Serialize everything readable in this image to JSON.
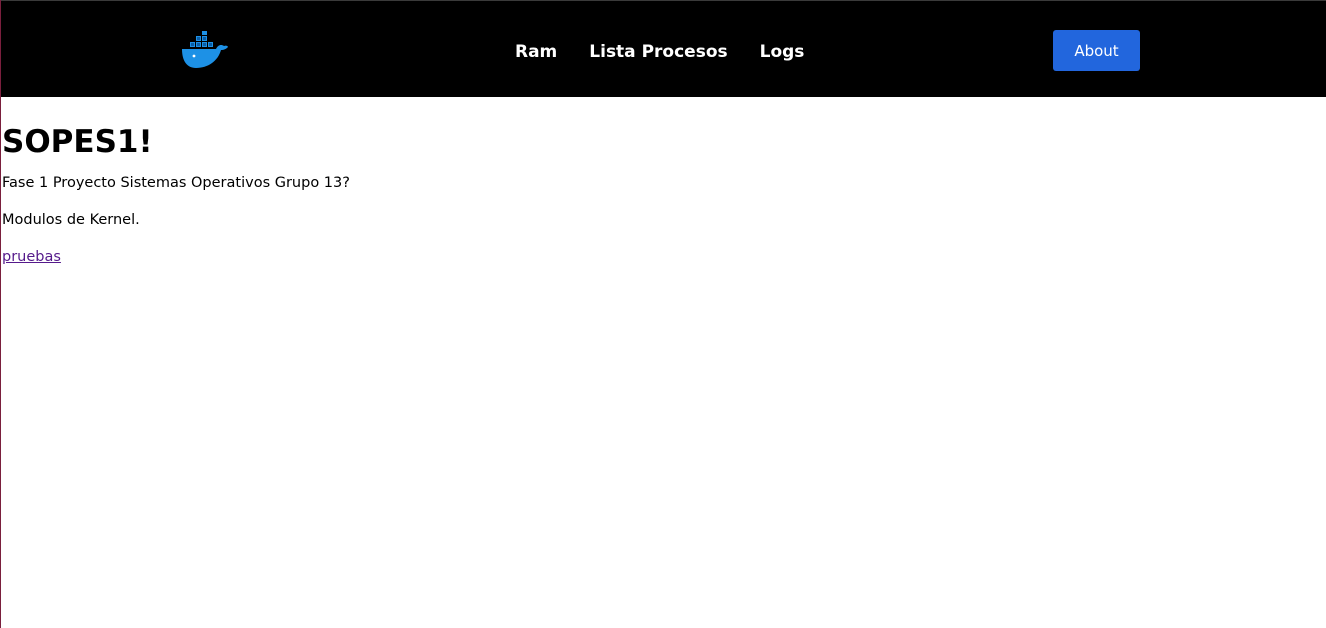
{
  "header": {
    "logo_icon": "docker-whale-icon",
    "nav": [
      {
        "label": "Ram"
      },
      {
        "label": "Lista Procesos"
      },
      {
        "label": "Logs"
      }
    ],
    "about_label": "About",
    "about_color": "#2266dd"
  },
  "main": {
    "title": "SOPES1!",
    "paragraphs": [
      "Fase 1 Proyecto Sistemas Operativos Grupo 13?",
      "Modulos de Kernel."
    ],
    "link_label": "pruebas",
    "link_color": "#551a8b"
  }
}
